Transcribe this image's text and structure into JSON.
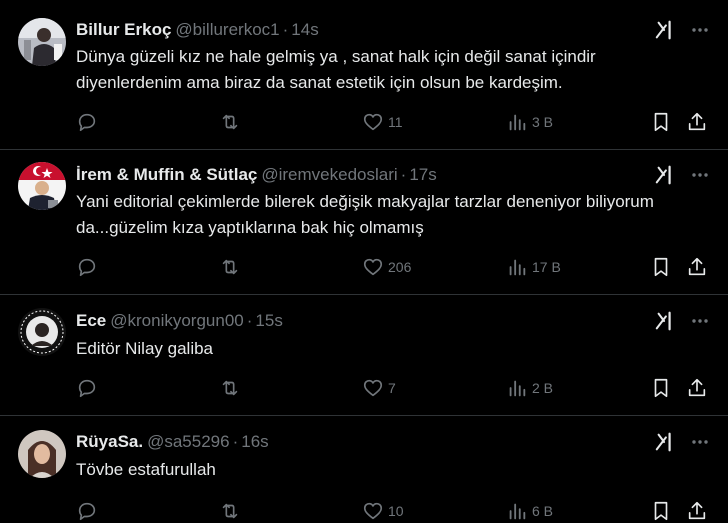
{
  "tweets": [
    {
      "name": "Billur Erkoç",
      "handle": "@billurerkoc1",
      "separator": "·",
      "time": "14s",
      "text": "Dünya güzeli kız ne hale gelmiş ya , sanat halk için değil sanat içindir diyenlerdenim ama biraz da sanat estetik için olsun be kardeşim.",
      "reply_count": "",
      "retweet_count": "",
      "like_count": "11",
      "view_count": "3 B",
      "avatar_icon": "avatar-person-photo"
    },
    {
      "name": "İrem & Muffin & Sütlaç",
      "handle": "@iremvekedoslari",
      "separator": "·",
      "time": "17s",
      "text": "Yani editorial çekimlerde bilerek değişik makyajlar tarzlar deneniyor biliyorum da...güzelim kıza yaptıklarına bak hiç olmamış",
      "reply_count": "",
      "retweet_count": "",
      "like_count": "206",
      "view_count": "17 B",
      "avatar_icon": "avatar-flag-photo"
    },
    {
      "name": "Ece",
      "handle": "@kronikyorgun00",
      "separator": "·",
      "time": "15s",
      "text": "Editör Nilay galiba",
      "reply_count": "",
      "retweet_count": "",
      "like_count": "7",
      "view_count": "2 B",
      "avatar_icon": "avatar-badge-photo"
    },
    {
      "name": "RüyaSa.",
      "handle": "@sa55296",
      "separator": "·",
      "time": "16s",
      "text": "Tövbe estafurullah",
      "reply_count": "",
      "retweet_count": "",
      "like_count": "10",
      "view_count": "6 B",
      "avatar_icon": "avatar-portrait-photo"
    }
  ],
  "colors": {
    "background": "#000000",
    "text_primary": "#e7e9ea",
    "text_secondary": "#71767b",
    "divider": "#2f3336"
  },
  "icons": [
    "grok-icon",
    "more-icon",
    "reply-icon",
    "retweet-icon",
    "like-icon",
    "views-icon",
    "bookmark-icon",
    "share-icon"
  ]
}
